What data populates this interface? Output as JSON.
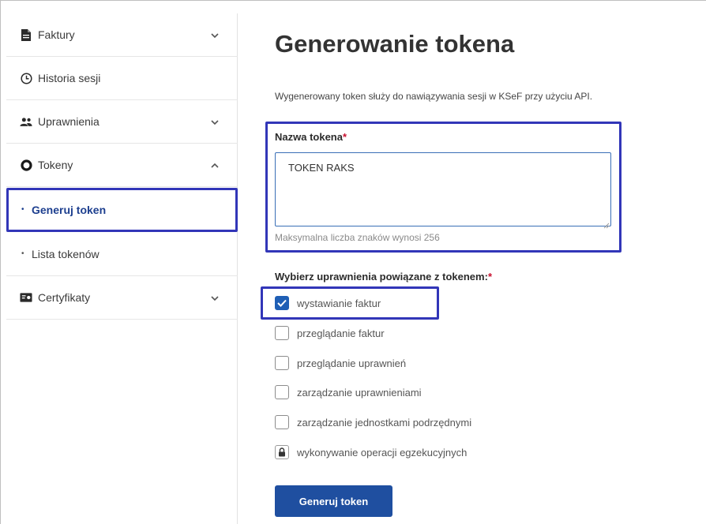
{
  "sidebar": {
    "items": [
      {
        "label": "Faktury",
        "icon": "document-icon"
      },
      {
        "label": "Historia sesji",
        "icon": "clock-icon"
      },
      {
        "label": "Uprawnienia",
        "icon": "users-icon"
      },
      {
        "label": "Tokeny",
        "icon": "token-icon"
      },
      {
        "label": "Certyfikaty",
        "icon": "certificate-icon"
      }
    ],
    "subitems": [
      {
        "label": "Generuj token",
        "active": true
      },
      {
        "label": "Lista tokenów",
        "active": false
      }
    ]
  },
  "main": {
    "title": "Generowanie tokena",
    "description": "Wygenerowany token służy do nawiązywania sesji w KSeF przy użyciu API.",
    "token_name": {
      "label": "Nazwa tokena",
      "required_mark": "*",
      "value": "TOKEN RAKS",
      "hint": "Maksymalna liczba znaków wynosi 256"
    },
    "permissions": {
      "label": "Wybierz uprawnienia powiązane z tokenem:",
      "required_mark": "*",
      "options": [
        {
          "label": "wystawianie faktur",
          "checked": true,
          "locked": false
        },
        {
          "label": "przeglądanie faktur",
          "checked": false,
          "locked": false
        },
        {
          "label": "przeglądanie uprawnień",
          "checked": false,
          "locked": false
        },
        {
          "label": "zarządzanie uprawnieniami",
          "checked": false,
          "locked": false
        },
        {
          "label": "zarządzanie jednostkami podrzędnymi",
          "checked": false,
          "locked": false
        },
        {
          "label": "wykonywanie operacji egzekucyjnych",
          "checked": false,
          "locked": true
        }
      ]
    },
    "submit_label": "Generuj token"
  },
  "colors": {
    "accent": "#1f4fa0",
    "highlight_box": "#3236b8",
    "active_nav_text": "#1d3f8f",
    "required": "#c8102e"
  }
}
